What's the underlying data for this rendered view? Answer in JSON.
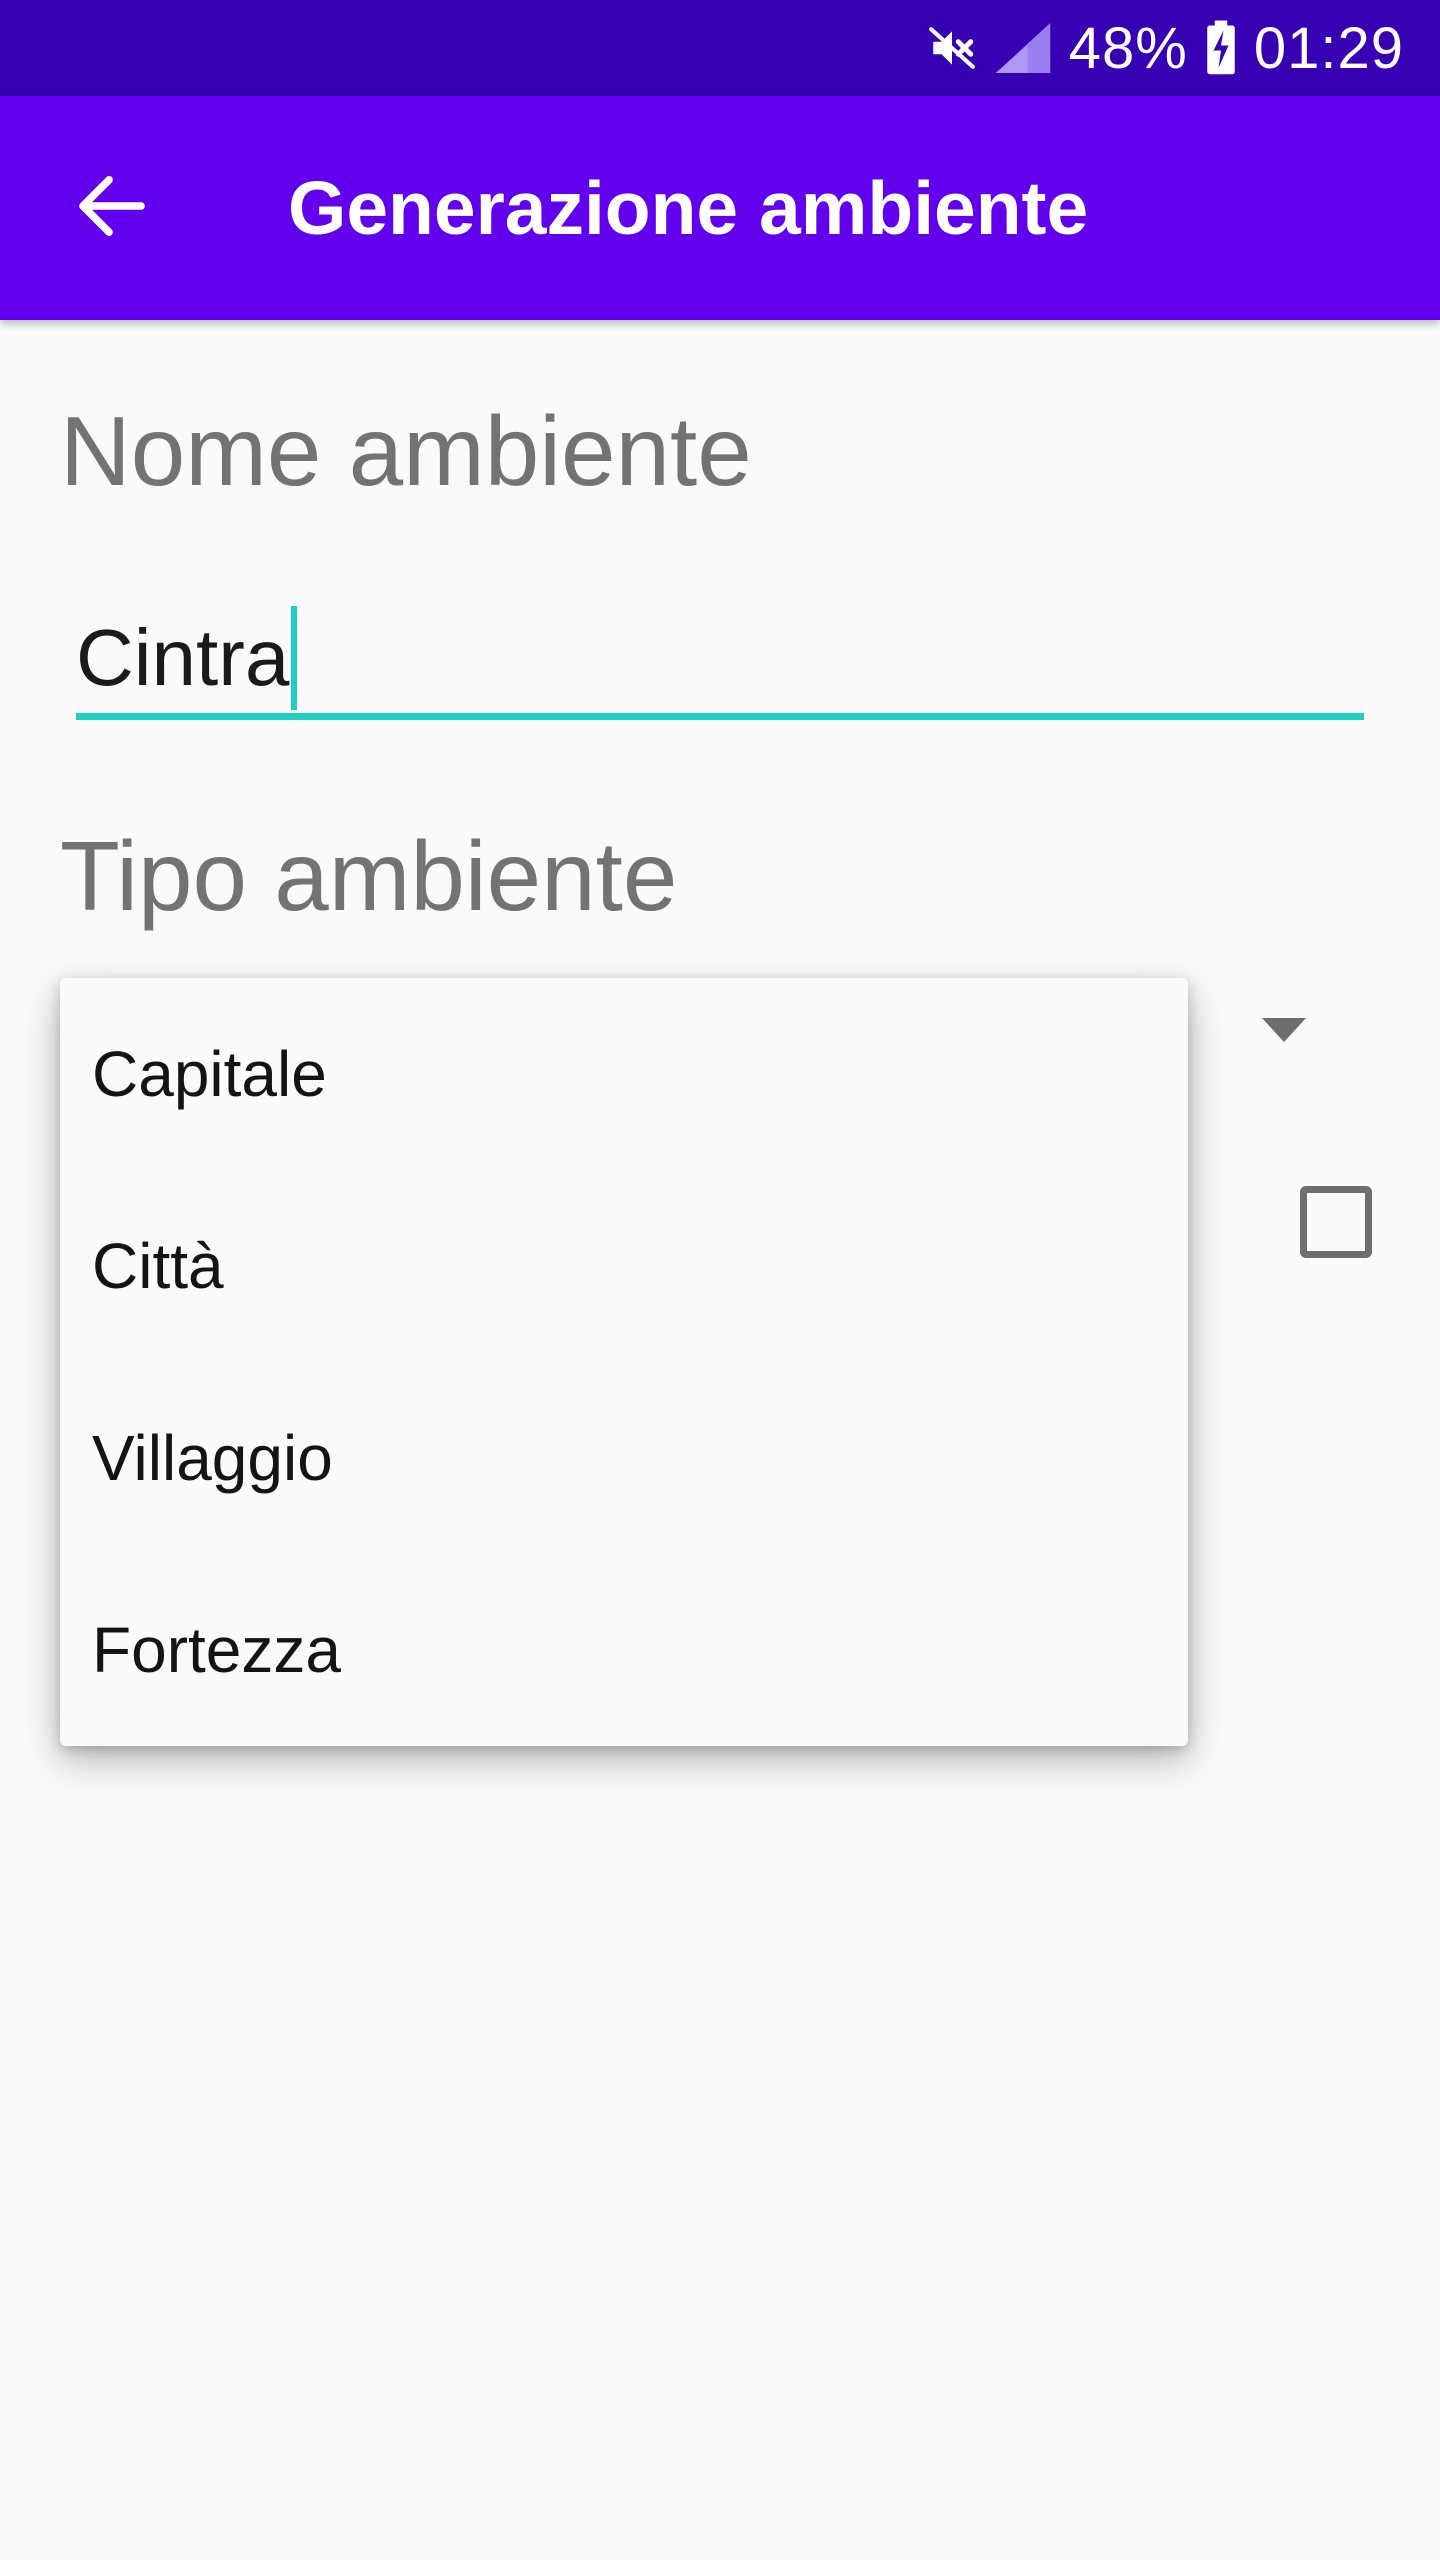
{
  "status_bar": {
    "battery": "48%",
    "time": "01:29",
    "icons": [
      "mute-icon",
      "signal-icon",
      "battery-charging-icon"
    ]
  },
  "app_bar": {
    "title": "Generazione ambiente",
    "back_icon": "arrow-back-icon"
  },
  "form": {
    "name_label": "Nome ambiente",
    "name_value": "Cintra",
    "type_label": "Tipo ambiente",
    "checkbox_checked": false
  },
  "dropdown": {
    "options": [
      "Capitale",
      "Città",
      "Villaggio",
      "Fortezza"
    ]
  },
  "colors": {
    "status_bar": "#3700b3",
    "app_bar": "#6200ee",
    "accent": "#1fcfc1",
    "label": "#737373"
  }
}
